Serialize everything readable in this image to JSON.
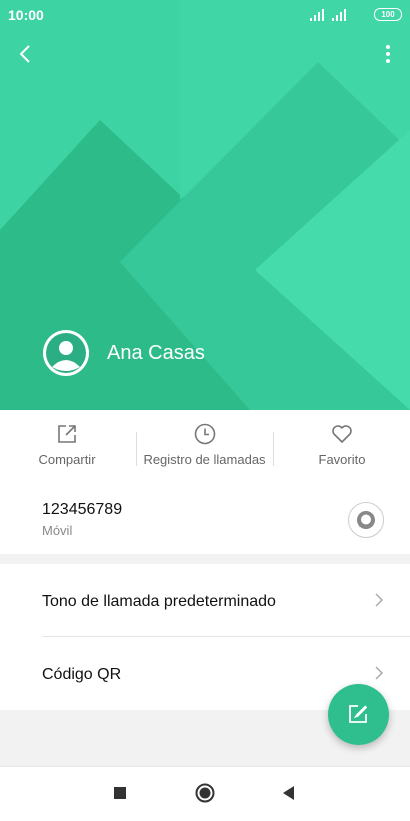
{
  "status_bar": {
    "time": "10:00",
    "battery": "100"
  },
  "contact": {
    "name": "Ana Casas"
  },
  "actions": [
    {
      "label": "Compartir",
      "icon": "share-icon"
    },
    {
      "label": "Registro de llamadas",
      "icon": "clock-icon"
    },
    {
      "label": "Favorito",
      "icon": "heart-icon"
    }
  ],
  "phone": {
    "number": "123456789",
    "type": "Móvil"
  },
  "settings": [
    {
      "label": "Tono de llamada predeterminado"
    },
    {
      "label": "Código QR"
    }
  ],
  "colors": {
    "accent": "#3ed3a3",
    "fab": "#2fbf8e"
  }
}
